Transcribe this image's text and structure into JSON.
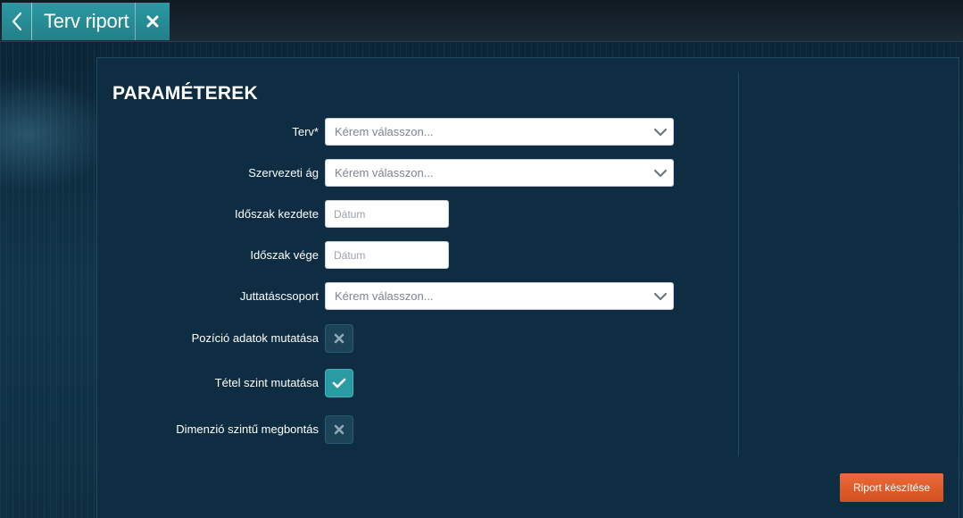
{
  "tab": {
    "title": "Terv riport"
  },
  "section": {
    "title": "PARAMÉTEREK"
  },
  "fields": {
    "terv": {
      "label": "Terv*",
      "placeholder": "Kérem válasszon..."
    },
    "szervezeti_ag": {
      "label": "Szervezeti ág",
      "placeholder": "Kérem válasszon..."
    },
    "idoszak_kezdete": {
      "label": "Időszak kezdete",
      "placeholder": "Dátum"
    },
    "idoszak_vege": {
      "label": "Időszak vége",
      "placeholder": "Dátum"
    },
    "juttatascsoport": {
      "label": "Juttatáscsoport",
      "placeholder": "Kérem válasszon..."
    }
  },
  "toggles": {
    "pozicio": {
      "label": "Pozíció adatok mutatása",
      "checked": false
    },
    "tetel": {
      "label": "Tétel szint mutatása",
      "checked": true
    },
    "dimenzio": {
      "label": "Dimenzió szintű megbontás",
      "checked": false
    }
  },
  "actions": {
    "submit_label": "Riport készítése"
  },
  "colors": {
    "accent": "#2a9aa3",
    "primary_button": "#e05a2a",
    "panel": "#0f2d42"
  }
}
